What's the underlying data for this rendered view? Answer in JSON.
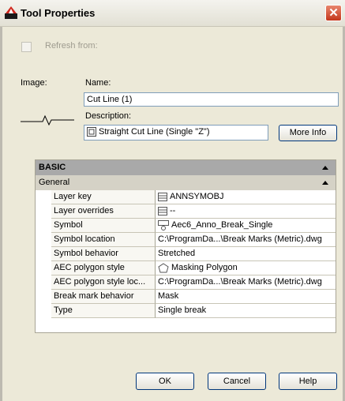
{
  "window": {
    "title": "Tool Properties",
    "close_glyph": "✕"
  },
  "refresh": {
    "label": "Refresh from:"
  },
  "image": {
    "label": "Image:"
  },
  "name": {
    "label": "Name:",
    "value": "Cut Line (1)"
  },
  "description": {
    "label": "Description:",
    "value": "Straight Cut Line (Single \"Z\")"
  },
  "buttons": {
    "more_info": "More Info",
    "ok": "OK",
    "cancel": "Cancel",
    "help": "Help"
  },
  "properties": {
    "category": "BASIC",
    "group": "General",
    "rows": [
      {
        "name": "Layer key",
        "value": "ANNSYMOBJ",
        "icon": "layer-key-icon"
      },
      {
        "name": "Layer overrides",
        "value": "--",
        "icon": "layer-overrides-icon"
      },
      {
        "name": "Symbol",
        "value": "Aec6_Anno_Break_Single",
        "icon": "symbol-icon"
      },
      {
        "name": "Symbol location",
        "value": "C:\\ProgramDa...\\Break Marks (Metric).dwg",
        "icon": ""
      },
      {
        "name": "Symbol behavior",
        "value": "Stretched",
        "icon": ""
      },
      {
        "name": "AEC polygon style",
        "value": "Masking Polygon",
        "icon": "polygon-icon"
      },
      {
        "name": "AEC polygon style loc...",
        "value": "C:\\ProgramDa...\\Break Marks (Metric).dwg",
        "icon": ""
      },
      {
        "name": "Break mark behavior",
        "value": "Mask",
        "icon": ""
      },
      {
        "name": "Type",
        "value": "Single break",
        "icon": ""
      }
    ]
  }
}
